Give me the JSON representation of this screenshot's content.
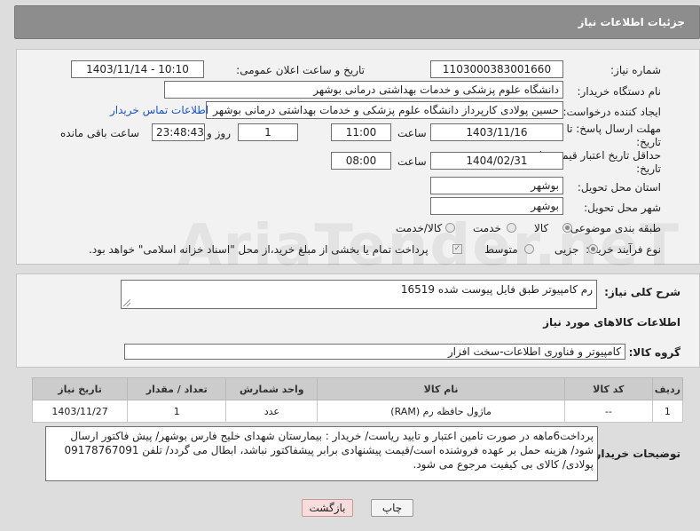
{
  "header": {
    "title": "جزئیات اطلاعات نیاز"
  },
  "form": {
    "need_number_label": "شماره نیاز:",
    "need_number": "1103000383001660",
    "announce_label": "تاریخ و ساعت اعلان عمومی:",
    "announce_value": "1403/11/14 - 10:10",
    "buyer_org_label": "نام دستگاه خریدار:",
    "buyer_org": "دانشگاه علوم پزشکی و خدمات بهداشتی درمانی بوشهر",
    "creator_label": "ایجاد کننده درخواست:",
    "creator": "حسین پولادی کارپرداز دانشگاه علوم پزشکی و خدمات بهداشتی درمانی بوشهر",
    "contact_link": "اطلاعات تماس خریدار",
    "deadline_label_1": "مهلت ارسال پاسخ: تا",
    "deadline_label_2": "تاریخ:",
    "deadline_date": "1403/11/16",
    "time_label": "ساعت",
    "deadline_time": "11:00",
    "days_value": "1",
    "days_label": "روز و",
    "remaining_time": "23:48:43",
    "remaining_label": "ساعت باقی مانده",
    "min_validity_label_1": "حداقل تاریخ اعتبار قیمت: تا",
    "min_validity_label_2": "تاریخ:",
    "validity_date": "1404/02/31",
    "validity_time": "08:00",
    "province_label": "استان محل تحویل:",
    "province": "بوشهر",
    "city_label": "شهر محل تحویل:",
    "city": "بوشهر",
    "category_label": "طبقه بندی موضوعی:",
    "category_options": [
      "کالا",
      "خدمت",
      "کالا/خدمت"
    ],
    "purchase_type_label": "نوع فرآیند خرید :",
    "purchase_options": [
      "جزیی",
      "متوسط"
    ],
    "payment_note": "پرداخت تمام یا بخشی از مبلغ خرید،از محل \"اسناد خزانه اسلامی\" خواهد بود."
  },
  "need_desc": {
    "label": "شرح کلی نیاز:",
    "value": "رم کامپیوتر طبق فایل پیوست شده 16519"
  },
  "goods": {
    "section_title": "اطلاعات کالاهای مورد نیاز",
    "group_label": "گروه کالا:",
    "group_value": "کامپیوتر و فناوری اطلاعات-سخت افزار",
    "columns": [
      "ردیف",
      "کد کالا",
      "نام کالا",
      "واحد شمارش",
      "تعداد / مقدار",
      "تاریخ نیاز"
    ],
    "rows": [
      [
        "1",
        "--",
        "ماژول حافظه رم (RAM)",
        "عدد",
        "1",
        "1403/11/27"
      ]
    ]
  },
  "buyer_notes": {
    "label": "توضیحات خریدار:",
    "value": "پرداخت6ماهه در صورت تامین اعتبار و تایید ریاست/ خریدار : بیمارستان شهدای خلیج فارس بوشهر/ پیش فاکتور ارسال شود/ هزینه حمل بر عهده فروشنده است/قیمت پیشنهادی برابر پیشفاکتور نباشد، ابطال می گردد/ تلفن 09178767091 پولادی/ کالای بی کیفیت مرجوع می شود."
  },
  "buttons": {
    "print": "چاپ",
    "back": "بازگشت"
  },
  "watermark": "AriaTender.neT"
}
